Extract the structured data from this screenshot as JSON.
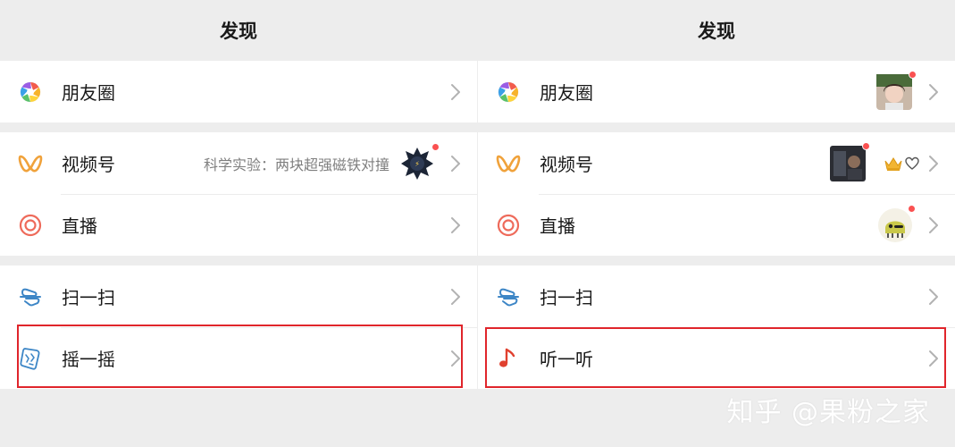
{
  "colors": {
    "background": "#ededed",
    "row_background": "#ffffff",
    "text": "#191919",
    "subtext": "#7f7f7f",
    "chevron": "#b2b2b2",
    "notification_dot": "#fa5151",
    "highlight_border": "#e0252b",
    "channels_icon": "#f0a23b",
    "live_icon": "#ee6a5a",
    "scan_icon": "#3d86c6",
    "listen_icon": "#e0402f"
  },
  "left": {
    "title": "发现",
    "moments": {
      "label": "朋友圈",
      "icon": "moments-aperture-icon"
    },
    "channels": {
      "label": "视频号",
      "subtext": "科学实验：两块超强磁铁对撞",
      "icon": "channels-icon"
    },
    "live": {
      "label": "直播",
      "icon": "live-icon"
    },
    "scan": {
      "label": "扫一扫",
      "icon": "scan-icon"
    },
    "shake": {
      "label": "摇一摇",
      "icon": "shake-icon"
    }
  },
  "right": {
    "title": "发现",
    "moments": {
      "label": "朋友圈",
      "icon": "moments-aperture-icon"
    },
    "channels": {
      "label": "视频号",
      "icon": "channels-icon",
      "extra_icons": [
        "crown-icon",
        "heart-outline-icon"
      ]
    },
    "live": {
      "label": "直播",
      "icon": "live-icon"
    },
    "scan": {
      "label": "扫一扫",
      "icon": "scan-icon"
    },
    "listen": {
      "label": "听一听",
      "icon": "music-note-icon"
    }
  },
  "watermark": "知乎 @果粉之家"
}
